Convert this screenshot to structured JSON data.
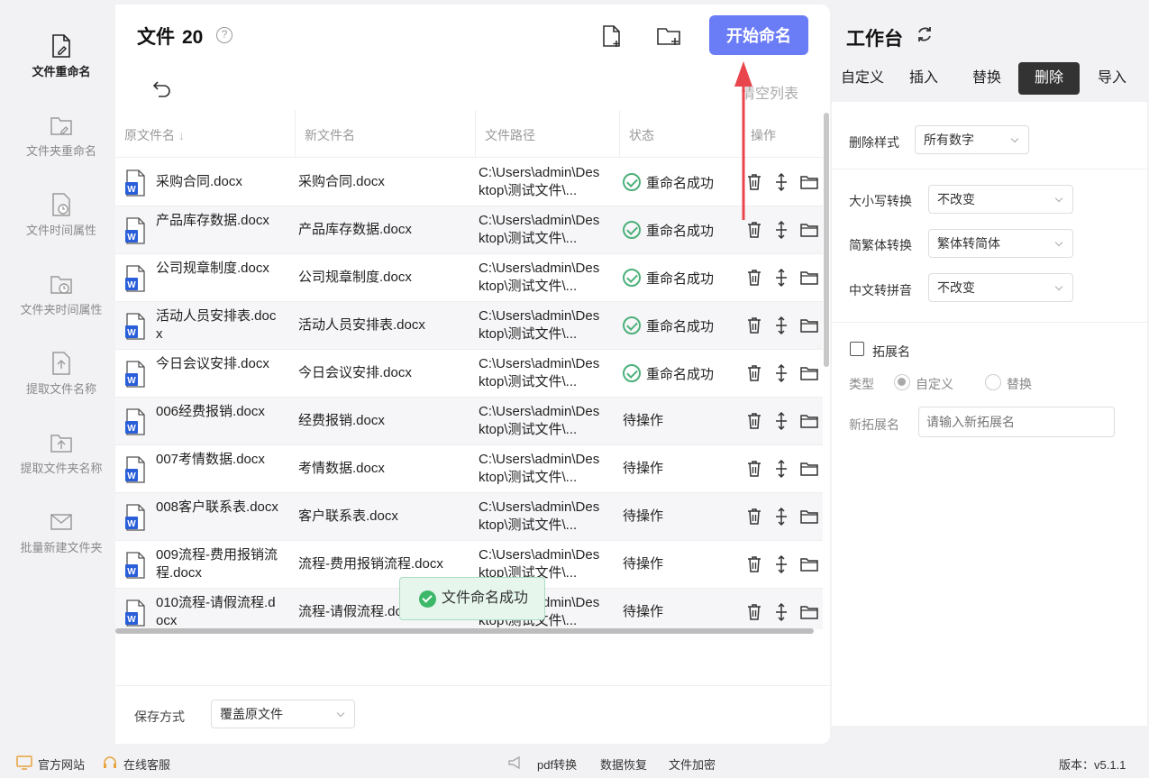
{
  "nav": {
    "items": [
      {
        "label": "文件重命名",
        "active": true
      },
      {
        "label": "文件夹重命名"
      },
      {
        "label": "文件时间属性"
      },
      {
        "label": "文件夹时间属性"
      },
      {
        "label": "提取文件名称"
      },
      {
        "label": "提取文件夹名称"
      },
      {
        "label": "批量新建文件夹"
      }
    ]
  },
  "header": {
    "title": "文件",
    "count": "20",
    "help": "?",
    "start_button": "开始命名",
    "clear_list": "清空列表"
  },
  "table": {
    "columns": [
      "原文件名",
      "新文件名",
      "文件路径",
      "状态",
      "操作"
    ],
    "rows": [
      {
        "orig": "采购合同.docx",
        "new": "采购合同.docx",
        "path": "C:\\Users\\admin\\Desktop\\测试文件\\...",
        "status": "重命名成功",
        "ok": true
      },
      {
        "orig": "产品库存数据.docx",
        "new": "产品库存数据.docx",
        "path": "C:\\Users\\admin\\Desktop\\测试文件\\...",
        "status": "重命名成功",
        "ok": true
      },
      {
        "orig": "公司规章制度.docx",
        "new": "公司规章制度.docx",
        "path": "C:\\Users\\admin\\Desktop\\测试文件\\...",
        "status": "重命名成功",
        "ok": true
      },
      {
        "orig": "活动人员安排表.docx",
        "new": "活动人员安排表.docx",
        "path": "C:\\Users\\admin\\Desktop\\测试文件\\...",
        "status": "重命名成功",
        "ok": true
      },
      {
        "orig": "今日会议安排.docx",
        "new": "今日会议安排.docx",
        "path": "C:\\Users\\admin\\Desktop\\测试文件\\...",
        "status": "重命名成功",
        "ok": true
      },
      {
        "orig": "006经费报销.docx",
        "new": "经费报销.docx",
        "path": "C:\\Users\\admin\\Desktop\\测试文件\\...",
        "status": "待操作",
        "ok": false
      },
      {
        "orig": "007考情数据.docx",
        "new": "考情数据.docx",
        "path": "C:\\Users\\admin\\Desktop\\测试文件\\...",
        "status": "待操作",
        "ok": false
      },
      {
        "orig": "008客户联系表.docx",
        "new": "客户联系表.docx",
        "path": "C:\\Users\\admin\\Desktop\\测试文件\\...",
        "status": "待操作",
        "ok": false
      },
      {
        "orig": "009流程-费用报销流程.docx",
        "new": "流程-费用报销流程.docx",
        "path": "C:\\Users\\admin\\Desktop\\测试文件\\...",
        "status": "待操作",
        "ok": false
      },
      {
        "orig": "010流程-请假流程.docx",
        "new": "流程-请假流程.docx",
        "path": "C:\\Users\\admin\\Desktop\\测试文件\\...",
        "status": "待操作",
        "ok": false
      }
    ]
  },
  "toast": "文件命名成功",
  "footer": {
    "save_label": "保存方式",
    "save_value": "覆盖原文件"
  },
  "workspace": {
    "title": "工作台",
    "tabs": [
      {
        "label": "自定义"
      },
      {
        "label": "插入"
      },
      {
        "label": "替换"
      },
      {
        "label": "删除",
        "active": true
      },
      {
        "label": "导入"
      }
    ],
    "delete_style_label": "删除样式",
    "delete_style_value": "所有数字",
    "case_label": "大小写转换",
    "case_value": "不改变",
    "trad_label": "简繁体转换",
    "trad_value": "繁体转简体",
    "pinyin_label": "中文转拼音",
    "pinyin_value": "不改变",
    "ext_checkbox": "拓展名",
    "type_label": "类型",
    "type_custom": "自定义",
    "type_replace": "替换",
    "new_ext_label": "新拓展名",
    "new_ext_placeholder": "请输入新拓展名"
  },
  "bottom": {
    "website": "官方网站",
    "service": "在线客服",
    "pdf": "pdf转换",
    "recover": "数据恢复",
    "encrypt": "文件加密",
    "version": "版本：v5.1.1"
  },
  "colors": {
    "accent": "#6b7cf7",
    "success": "#4cb07a",
    "arrow": "#e8464c",
    "active_tab": "#333333",
    "word_blue": "#2b5fd9"
  }
}
